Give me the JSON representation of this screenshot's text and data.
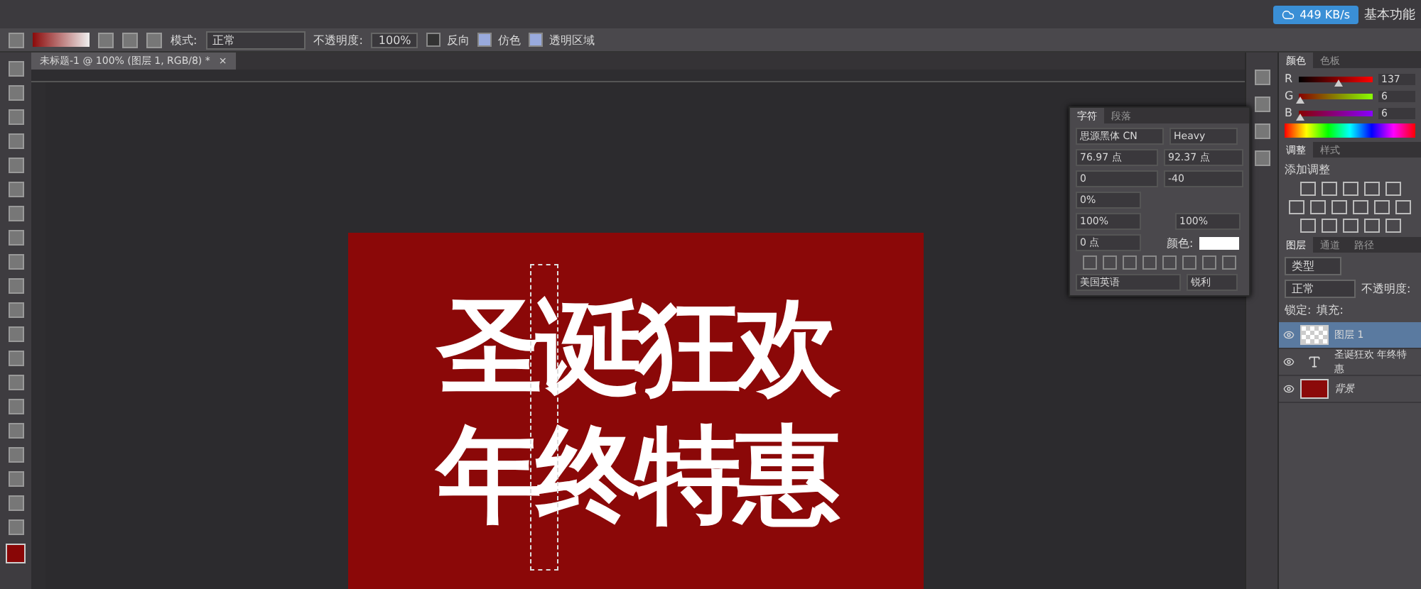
{
  "options_bar": {
    "mode_label": "模式:",
    "mode_value": "正常",
    "opacity_label": "不透明度:",
    "opacity_value": "100%",
    "checks": [
      {
        "label": "反向",
        "checked": false
      },
      {
        "label": "仿色",
        "checked": true
      },
      {
        "label": "透明区域",
        "checked": true
      }
    ]
  },
  "net_speed": "449 KB/s",
  "workspace": "基本功能",
  "document_tab": {
    "title": "未标题-1 @ 100% (图层 1, RGB/8) *",
    "close": "×"
  },
  "canvas": {
    "lines": [
      "圣诞狂欢",
      "年终特惠"
    ]
  },
  "character_panel": {
    "tabs": [
      {
        "label": "字符",
        "selected": true
      },
      {
        "label": "段落",
        "selected": false
      }
    ],
    "font_family": "思源黑体 CN",
    "font_style": "Heavy",
    "size": "76.97 点",
    "leading": "92.37 点",
    "kerning": "0",
    "tracking": "-40",
    "scale_percent": "0%",
    "vertical_scale": "100%",
    "horizontal_scale": "100%",
    "baseline_shift": "0 点",
    "color_label": "颜色:",
    "language": "美国英语",
    "antialias": "锐利"
  },
  "color_panel": {
    "tabs": [
      {
        "label": "颜色",
        "selected": true
      },
      {
        "label": "色板",
        "selected": false
      }
    ],
    "channels": [
      {
        "name": "R",
        "value": "137",
        "level": 0.54
      },
      {
        "name": "G",
        "value": "6",
        "level": 0.02
      },
      {
        "name": "B",
        "value": "6",
        "level": 0.02
      }
    ]
  },
  "adjustments_panel": {
    "tabs": [
      {
        "label": "调整",
        "selected": true
      },
      {
        "label": "样式",
        "selected": false
      }
    ],
    "title": "添加调整"
  },
  "layers_panel": {
    "tabs": [
      {
        "label": "图层",
        "selected": true
      },
      {
        "label": "通道",
        "selected": false
      },
      {
        "label": "路径",
        "selected": false
      }
    ],
    "filter": "类型",
    "blend": "正常",
    "opacity_label": "不透明度:",
    "lock_label": "锁定:",
    "fill_label": "填充:",
    "layers": [
      {
        "kind": "pixel",
        "name": "图层 1",
        "selected": true
      },
      {
        "kind": "text",
        "name": "圣诞狂欢 年终特惠",
        "selected": false
      },
      {
        "kind": "fill",
        "name": "背景",
        "selected": false,
        "color": "#8b0a0a"
      }
    ]
  }
}
